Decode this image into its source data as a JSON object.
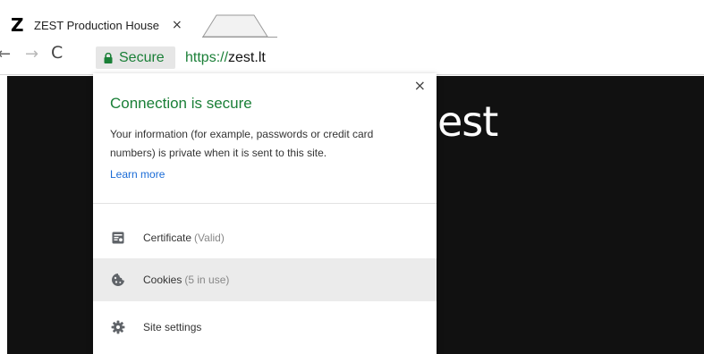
{
  "tab": {
    "favicon_letter": "Z",
    "title": "ZEST Production House",
    "close_glyph": "×"
  },
  "toolbar": {
    "back_glyph": "←",
    "forward_glyph": "→",
    "reload_glyph": "C",
    "secure_label": "Secure",
    "url_scheme": "https://",
    "url_host": "zest.lt"
  },
  "page": {
    "logo_text": "est"
  },
  "popup": {
    "title": "Connection is secure",
    "description": "Your information (for example, passwords or credit card numbers) is private when it is sent to this site.",
    "learn_more": "Learn more",
    "close_glyph": "×",
    "items": [
      {
        "label": "Certificate",
        "detail": "(Valid)",
        "icon": "certificate-icon"
      },
      {
        "label": "Cookies",
        "detail": "(5 in use)",
        "icon": "cookie-icon"
      },
      {
        "label": "Site settings",
        "detail": "",
        "icon": "gear-icon"
      }
    ]
  },
  "colors": {
    "secure_green": "#1a7f37",
    "link_blue": "#1a6bd6",
    "page_background": "#000000"
  }
}
